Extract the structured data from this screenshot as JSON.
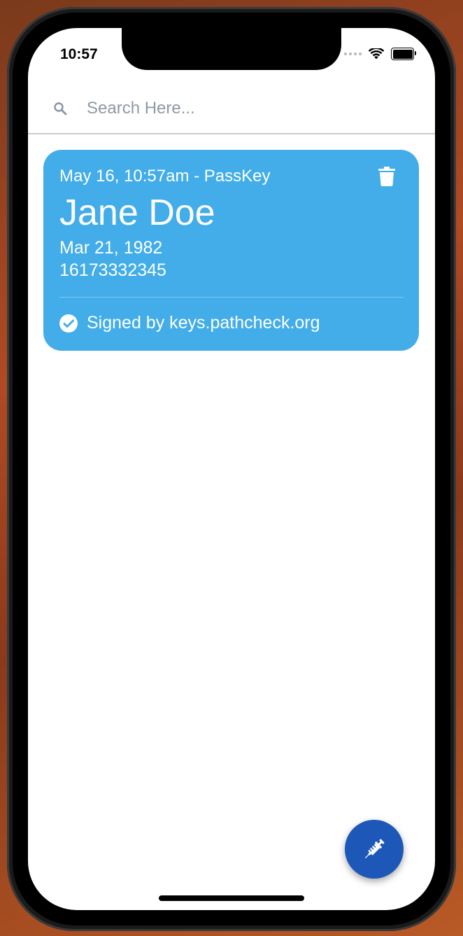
{
  "status_bar": {
    "time": "10:57"
  },
  "search": {
    "placeholder": "Search Here..."
  },
  "card": {
    "meta": "May 16, 10:57am - PassKey",
    "name": "Jane Doe",
    "dob": "Mar 21, 1982",
    "phone": "16173332345",
    "signed_by": "Signed by keys.pathcheck.org",
    "color": "#42ade8"
  },
  "fab": {
    "icon": "syringe-icon",
    "color": "#1d58b8"
  },
  "icons": {
    "search": "search-icon",
    "delete": "trash-icon",
    "verified": "check-circle-icon",
    "signal": "signal-icon",
    "wifi": "wifi-icon",
    "battery": "battery-icon"
  }
}
